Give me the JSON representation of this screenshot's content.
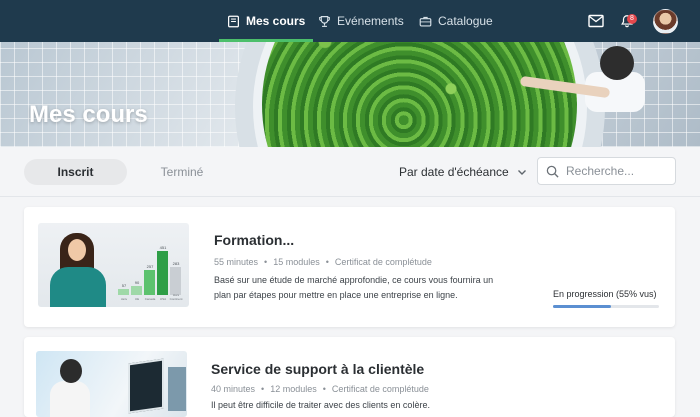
{
  "nav": {
    "items": [
      {
        "label": "Mes cours",
        "icon": "book-icon",
        "active": true
      },
      {
        "label": "Evénements",
        "icon": "trophy-icon",
        "active": false
      },
      {
        "label": "Catalogue",
        "icon": "briefcase-icon",
        "active": false
      }
    ],
    "notification_count": "8",
    "icons": [
      "mail-icon",
      "bell-icon",
      "avatar"
    ]
  },
  "hero": {
    "title": "Mes cours"
  },
  "filters": {
    "tabs": [
      {
        "label": "Inscrit",
        "active": true
      },
      {
        "label": "Terminé",
        "active": false
      }
    ],
    "sort_label": "Par date d'échéance",
    "search_placeholder": "Recherche..."
  },
  "courses": [
    {
      "title": "Formation...",
      "duration": "55 minutes",
      "modules": "15 modules",
      "certificate": "Certificat de complétude",
      "description": "Basé sur une étude de marché approfondie, ce cours vous fournira un plan par étapes pour mettre en place une entreprise en ligne.",
      "status": "En progression (55% vus)",
      "progress": 0.55,
      "thumbnail_chart": {
        "values": [
          "57",
          "90",
          "257",
          "451",
          "283"
        ],
        "categories": [
          "Janv",
          "UE",
          "Canada",
          "USA",
          "Hors Continent"
        ]
      }
    },
    {
      "title": "Service de support  à la clientèle",
      "duration": "40 minutes",
      "modules": "12 modules",
      "certificate": "Certificat de complétude",
      "description": "Il peut être difficile de traiter avec des clients en colère."
    }
  ],
  "colors": {
    "topbar": "#1f3a4d",
    "accent_green": "#4cbf6b",
    "progress_blue": "#5b8fd1",
    "badge_red": "#e5484d"
  }
}
